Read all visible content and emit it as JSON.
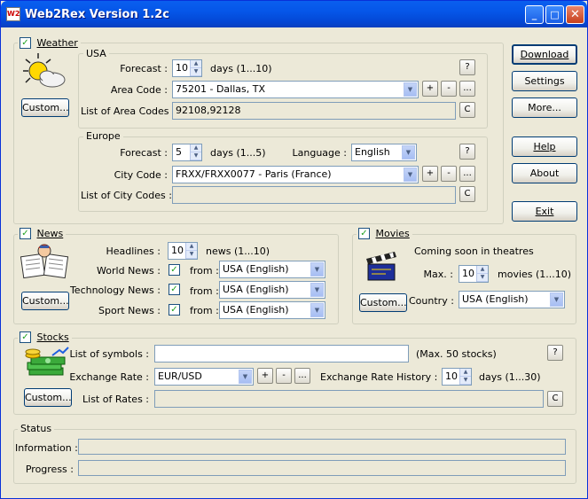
{
  "window": {
    "title": "Web2Rex Version 1.2c",
    "icon": "W2R",
    "minimize": "_",
    "maximize": "□",
    "close": "✕"
  },
  "weather": {
    "label": "Weather",
    "custom": "Custom...",
    "usa": {
      "label": "USA",
      "forecast_label": "Forecast :",
      "forecast_value": "10",
      "forecast_range": "days (1...10)",
      "help": "?",
      "area_code_label": "Area Code :",
      "area_code_value": "75201 - Dallas, TX",
      "add": "+",
      "remove": "-",
      "browse": "...",
      "list_label": "List of Area Codes :",
      "list_value": "92108,92128",
      "clear": "C"
    },
    "europe": {
      "label": "Europe",
      "forecast_label": "Forecast :",
      "forecast_value": "5",
      "forecast_range": "days (1...5)",
      "language_label": "Language :",
      "language_value": "English",
      "help": "?",
      "city_code_label": "City Code :",
      "city_code_value": "FRXX/FRXX0077 - Paris (France)",
      "add": "+",
      "remove": "-",
      "browse": "...",
      "list_label": "List of City Codes :",
      "list_value": "",
      "clear": "C"
    }
  },
  "side_buttons": {
    "download": "Download",
    "settings": "Settings",
    "more": "More...",
    "help": "Help",
    "about": "About",
    "exit": "Exit"
  },
  "news": {
    "label": "News",
    "custom": "Custom...",
    "headlines_label": "Headlines :",
    "headlines_value": "10",
    "headlines_range": "news (1...10)",
    "rows": [
      {
        "label": "World News :",
        "from": "from :",
        "value": "USA (English)"
      },
      {
        "label": "Technology News :",
        "from": "from :",
        "value": "USA (English)"
      },
      {
        "label": "Sport News :",
        "from": "from :",
        "value": "USA (English)"
      }
    ]
  },
  "movies": {
    "label": "Movies",
    "custom": "Custom...",
    "coming": "Coming soon in theatres",
    "max_label": "Max. :",
    "max_value": "10",
    "max_range": "movies (1...10)",
    "country_label": "Country :",
    "country_value": "USA (English)"
  },
  "stocks": {
    "label": "Stocks",
    "custom": "Custom...",
    "symbols_label": "List of symbols :",
    "symbols_value": "",
    "symbols_note": "(Max. 50 stocks)",
    "help": "?",
    "exchange_label": "Exchange Rate :",
    "exchange_value": "EUR/USD",
    "add": "+",
    "remove": "-",
    "browse": "...",
    "history_label": "Exchange Rate History :",
    "history_value": "10",
    "history_range": "days (1...30)",
    "rates_label": "List of Rates :",
    "rates_value": "",
    "clear": "C"
  },
  "status": {
    "label": "Status",
    "information_label": "Information :",
    "information_value": "",
    "progress_label": "Progress :",
    "progress_value": ""
  }
}
